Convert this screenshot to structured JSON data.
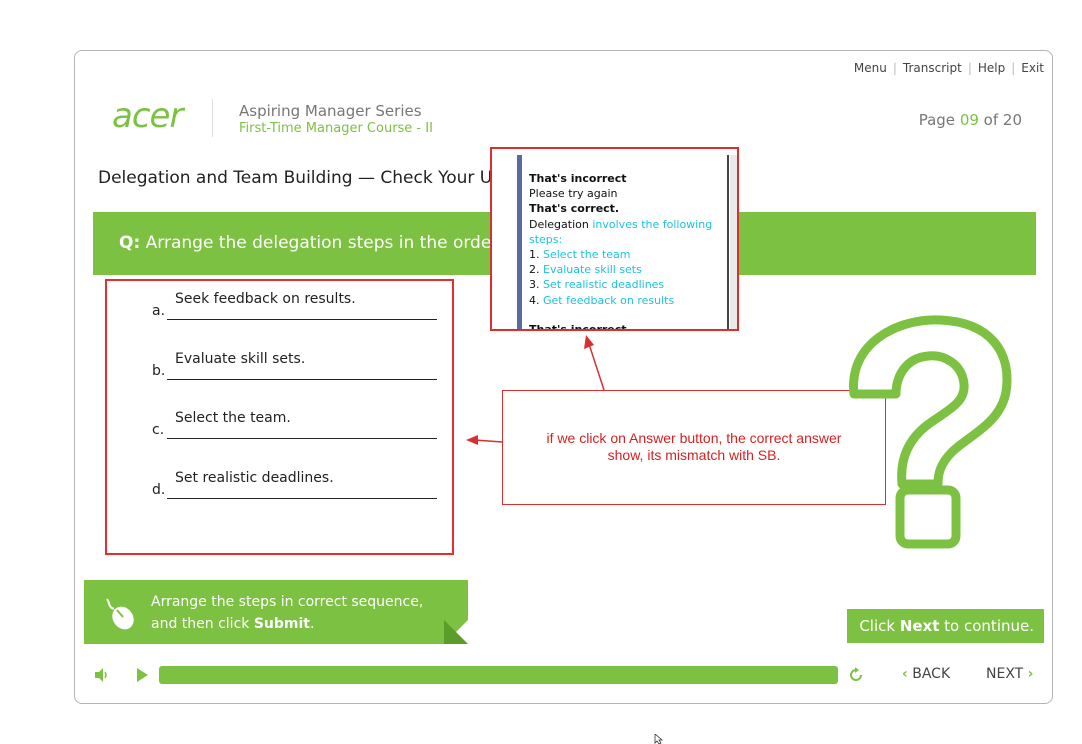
{
  "header": {
    "links": [
      "Menu",
      "Transcript",
      "Help",
      "Exit"
    ],
    "logo": "acer",
    "series": "Aspiring Manager Series",
    "course": "First-Time Manager Course - II",
    "page_prefix": "Page ",
    "page_current": "09",
    "page_suffix": " of 20"
  },
  "title": "Delegation and Team Building — Check Your Unde",
  "question": {
    "prefix": "Q:",
    "text": " Arrange the delegation steps in the order th"
  },
  "answers": [
    {
      "letter": "a.",
      "text": "Seek feedback on results."
    },
    {
      "letter": "b.",
      "text": "Evaluate skill sets."
    },
    {
      "letter": "c.",
      "text": "Select the team."
    },
    {
      "letter": "d.",
      "text": "Set realistic deadlines."
    }
  ],
  "popup": {
    "incorrect": "That's incorrect",
    "try_again": "Please try again",
    "correct": "That's correct.",
    "delegation_prefix": "Delegation ",
    "delegation_hl": "involves the following steps:",
    "steps": [
      {
        "num": "1. ",
        "text": "Select the team"
      },
      {
        "num": "2. ",
        "text": "Evaluate skill sets"
      },
      {
        "num": "3. ",
        "text": "Set realistic deadlines"
      },
      {
        "num": "4. ",
        "text": "Get feedback on results"
      }
    ],
    "trailing": "That's incorrect"
  },
  "annotation": {
    "line1": "if we click on Answer button, the correct answer",
    "line2": "show, its mismatch with SB."
  },
  "instruction": {
    "line1": "Arrange the steps in correct sequence,",
    "line2_prefix": "and then click ",
    "line2_bold": "Submit",
    "line2_suffix": "."
  },
  "next_prompt": {
    "prefix": "Click ",
    "bold": "Next",
    "suffix": " to continue."
  },
  "controls": {
    "back": "BACK",
    "next": "NEXT",
    "progress": 1.0
  },
  "colors": {
    "accent": "#7dc142",
    "annotation": "#d83030",
    "highlight": "#1ec2de"
  }
}
